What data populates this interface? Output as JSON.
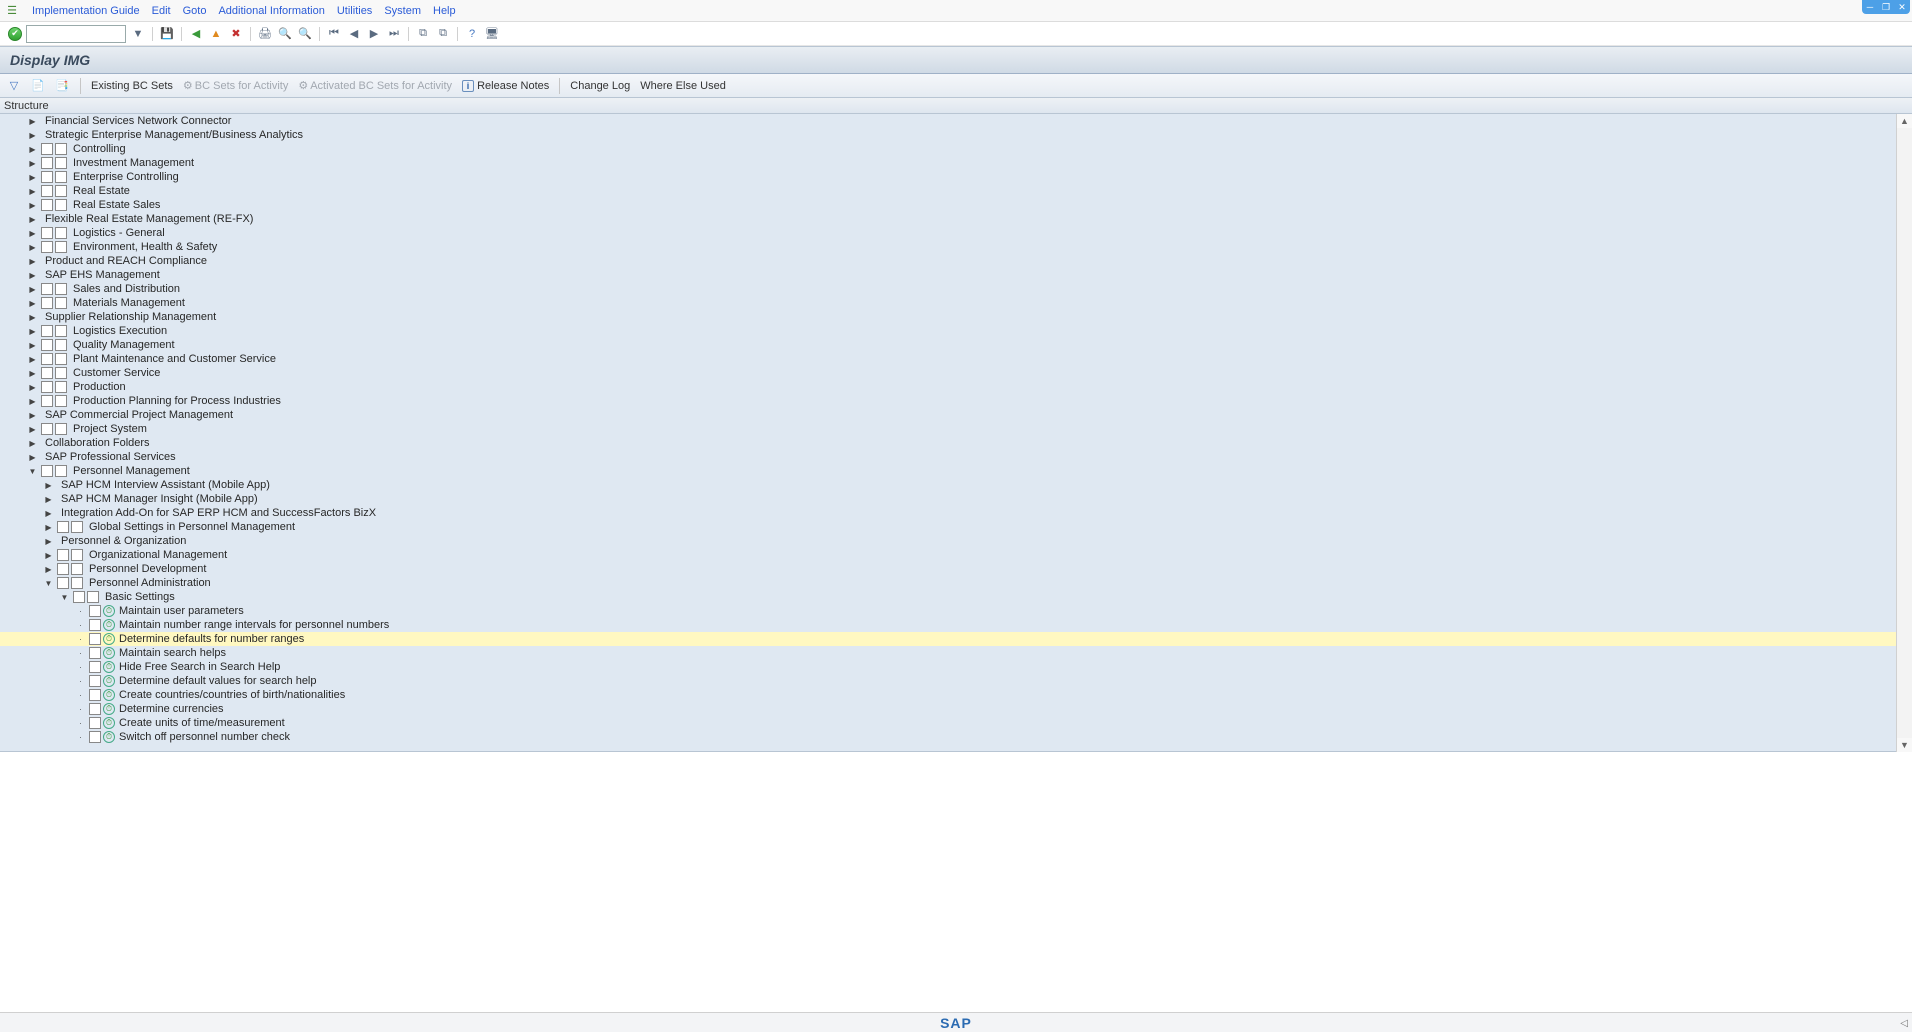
{
  "menu": [
    "Implementation Guide",
    "Edit",
    "Goto",
    "Additional Information",
    "Utilities",
    "System",
    "Help"
  ],
  "window_title": "Display IMG",
  "action_bar": {
    "existing": "Existing BC Sets",
    "bc_activity": "BC Sets for Activity",
    "activated": "Activated BC Sets for Activity",
    "release": "Release Notes",
    "change": "Change Log",
    "where": "Where Else Used"
  },
  "structure_label": "Structure",
  "tree": [
    {
      "indent": 1,
      "exp": "▶",
      "doc": false,
      "activity": false,
      "label": "Financial Services Network Connector"
    },
    {
      "indent": 1,
      "exp": "▶",
      "doc": false,
      "activity": false,
      "label": "Strategic Enterprise Management/Business Analytics"
    },
    {
      "indent": 1,
      "exp": "▶",
      "doc": true,
      "activity": true,
      "label": "Controlling"
    },
    {
      "indent": 1,
      "exp": "▶",
      "doc": true,
      "activity": true,
      "label": "Investment Management"
    },
    {
      "indent": 1,
      "exp": "▶",
      "doc": true,
      "activity": true,
      "label": "Enterprise Controlling"
    },
    {
      "indent": 1,
      "exp": "▶",
      "doc": true,
      "activity": true,
      "label": "Real Estate"
    },
    {
      "indent": 1,
      "exp": "▶",
      "doc": true,
      "activity": true,
      "label": "Real Estate Sales"
    },
    {
      "indent": 1,
      "exp": "▶",
      "doc": false,
      "activity": false,
      "label": "Flexible Real Estate Management (RE-FX)"
    },
    {
      "indent": 1,
      "exp": "▶",
      "doc": true,
      "activity": true,
      "label": "Logistics - General"
    },
    {
      "indent": 1,
      "exp": "▶",
      "doc": true,
      "activity": true,
      "label": "Environment, Health & Safety"
    },
    {
      "indent": 1,
      "exp": "▶",
      "doc": false,
      "activity": false,
      "label": "Product and REACH Compliance"
    },
    {
      "indent": 1,
      "exp": "▶",
      "doc": false,
      "activity": false,
      "label": "SAP EHS Management"
    },
    {
      "indent": 1,
      "exp": "▶",
      "doc": true,
      "activity": true,
      "label": "Sales and Distribution"
    },
    {
      "indent": 1,
      "exp": "▶",
      "doc": true,
      "activity": true,
      "label": "Materials Management"
    },
    {
      "indent": 1,
      "exp": "▶",
      "doc": false,
      "activity": false,
      "label": "Supplier Relationship Management"
    },
    {
      "indent": 1,
      "exp": "▶",
      "doc": true,
      "activity": true,
      "label": "Logistics Execution"
    },
    {
      "indent": 1,
      "exp": "▶",
      "doc": true,
      "activity": true,
      "label": "Quality Management"
    },
    {
      "indent": 1,
      "exp": "▶",
      "doc": true,
      "activity": true,
      "label": "Plant Maintenance and Customer Service"
    },
    {
      "indent": 1,
      "exp": "▶",
      "doc": true,
      "activity": true,
      "label": "Customer Service"
    },
    {
      "indent": 1,
      "exp": "▶",
      "doc": true,
      "activity": true,
      "label": "Production"
    },
    {
      "indent": 1,
      "exp": "▶",
      "doc": true,
      "activity": true,
      "label": "Production Planning for Process Industries"
    },
    {
      "indent": 1,
      "exp": "▶",
      "doc": false,
      "activity": false,
      "label": "SAP Commercial Project Management"
    },
    {
      "indent": 1,
      "exp": "▶",
      "doc": true,
      "activity": true,
      "label": "Project System"
    },
    {
      "indent": 1,
      "exp": "▶",
      "doc": false,
      "activity": false,
      "label": "Collaboration Folders"
    },
    {
      "indent": 1,
      "exp": "▶",
      "doc": false,
      "activity": false,
      "label": "SAP Professional Services"
    },
    {
      "indent": 1,
      "exp": "▼",
      "doc": true,
      "activity": true,
      "label": "Personnel Management"
    },
    {
      "indent": 2,
      "exp": "▶",
      "doc": false,
      "activity": false,
      "label": "SAP HCM Interview Assistant (Mobile App)"
    },
    {
      "indent": 2,
      "exp": "▶",
      "doc": false,
      "activity": false,
      "label": "SAP HCM Manager Insight (Mobile App)"
    },
    {
      "indent": 2,
      "exp": "▶",
      "doc": false,
      "activity": false,
      "label": "Integration Add-On for SAP ERP HCM and SuccessFactors BizX"
    },
    {
      "indent": 2,
      "exp": "▶",
      "doc": true,
      "activity": true,
      "label": "Global Settings in Personnel Management"
    },
    {
      "indent": 2,
      "exp": "▶",
      "doc": false,
      "activity": false,
      "label": "Personnel & Organization"
    },
    {
      "indent": 2,
      "exp": "▶",
      "doc": true,
      "activity": true,
      "label": "Organizational Management"
    },
    {
      "indent": 2,
      "exp": "▶",
      "doc": true,
      "activity": true,
      "label": "Personnel Development"
    },
    {
      "indent": 2,
      "exp": "▼",
      "doc": true,
      "activity": true,
      "label": "Personnel Administration"
    },
    {
      "indent": 3,
      "exp": "▼",
      "doc": true,
      "activity": true,
      "label": "Basic Settings"
    },
    {
      "indent": 4,
      "exp": "·",
      "doc": true,
      "clock": true,
      "label": "Maintain user parameters"
    },
    {
      "indent": 4,
      "exp": "·",
      "doc": true,
      "clock": true,
      "label": "Maintain number range intervals for personnel numbers"
    },
    {
      "indent": 4,
      "exp": "·",
      "doc": true,
      "clock": true,
      "label": "Determine defaults for number ranges",
      "highlight": true
    },
    {
      "indent": 4,
      "exp": "·",
      "doc": true,
      "clock": true,
      "label": "Maintain search helps"
    },
    {
      "indent": 4,
      "exp": "·",
      "doc": true,
      "clock": true,
      "label": "Hide Free Search in Search Help"
    },
    {
      "indent": 4,
      "exp": "·",
      "doc": true,
      "clock": true,
      "label": "Determine default values for search help"
    },
    {
      "indent": 4,
      "exp": "·",
      "doc": true,
      "clock": true,
      "label": "Create countries/countries of birth/nationalities"
    },
    {
      "indent": 4,
      "exp": "·",
      "doc": true,
      "clock": true,
      "label": "Determine currencies"
    },
    {
      "indent": 4,
      "exp": "·",
      "doc": true,
      "clock": true,
      "label": "Create units of time/measurement"
    },
    {
      "indent": 4,
      "exp": "·",
      "doc": true,
      "clock": true,
      "label": "Switch off personnel number check"
    }
  ],
  "sap_logo": "SAP"
}
